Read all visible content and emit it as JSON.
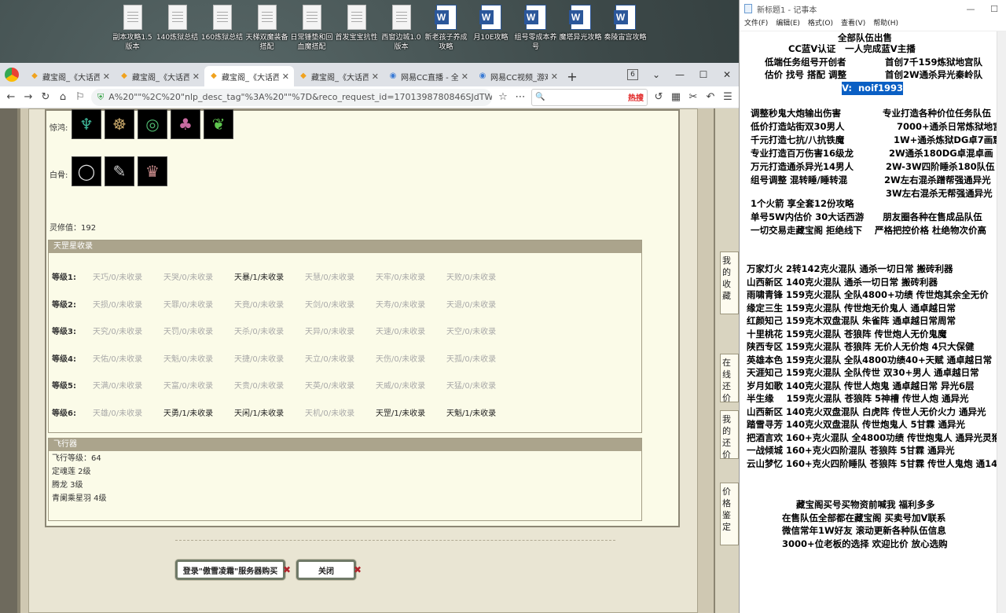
{
  "desktop": {
    "icons": [
      {
        "label": "副本攻略1.5版本",
        "type": "doc"
      },
      {
        "label": "140炼狱总结",
        "type": "doc"
      },
      {
        "label": "160炼狱总结",
        "type": "doc"
      },
      {
        "label": "天梯双魔装备搭配",
        "type": "doc"
      },
      {
        "label": "日常锤垫和回血魔搭配",
        "type": "doc"
      },
      {
        "label": "首发宝宝抗性",
        "type": "doc"
      },
      {
        "label": "西窗边城1.0版本",
        "type": "doc"
      },
      {
        "label": "新老孩子养成攻略",
        "type": "word"
      },
      {
        "label": "月10E攻略",
        "type": "word"
      },
      {
        "label": "组号零成本养号",
        "type": "word"
      },
      {
        "label": "魔塔异光攻略",
        "type": "word"
      },
      {
        "label": "奏陵宙宫攻略",
        "type": "word"
      }
    ]
  },
  "browser": {
    "tabs": [
      {
        "title": "藏宝阁_《大话西",
        "icon": "bao",
        "active": false
      },
      {
        "title": "藏宝阁_《大话西",
        "icon": "bao",
        "active": false
      },
      {
        "title": "藏宝阁_《大话西",
        "icon": "bao",
        "active": true
      },
      {
        "title": "藏宝阁_《大话西",
        "icon": "bao",
        "active": false
      },
      {
        "title": "网易CC直播 - 全",
        "icon": "cc",
        "active": false
      },
      {
        "title": "网易CC视频_游戏",
        "icon": "cc",
        "active": false
      }
    ],
    "tab_count": "6",
    "url": "A%20\"\"%2C%20\"nlp_desc_tag\"%3A%20\"\"%7D&reco_request_id=1701398780846SJdTW",
    "search_hot": "热搜"
  },
  "game": {
    "jinghong_label": "惊鸿:",
    "baifu_label": "白骨:",
    "lingxiu": "灵修值：192",
    "tiangang_header": "天罡星收录",
    "grades": [
      {
        "label": "等级1:",
        "cells": [
          {
            "t": "天巧/0/未收录",
            "on": false
          },
          {
            "t": "天哭/0/未收录",
            "on": false
          },
          {
            "t": "天暴/1/未收录",
            "on": true
          },
          {
            "t": "天慧/0/未收录",
            "on": false
          },
          {
            "t": "天牢/0/未收录",
            "on": false
          },
          {
            "t": "天败/0/未收录",
            "on": false
          }
        ]
      },
      {
        "label": "等级2:",
        "cells": [
          {
            "t": "天损/0/未收录",
            "on": false
          },
          {
            "t": "天罪/0/未收录",
            "on": false
          },
          {
            "t": "天竟/0/未收录",
            "on": false
          },
          {
            "t": "天剑/0/未收录",
            "on": false
          },
          {
            "t": "天寿/0/未收录",
            "on": false
          },
          {
            "t": "天退/0/未收录",
            "on": false
          }
        ]
      },
      {
        "label": "等级3:",
        "cells": [
          {
            "t": "天究/0/未收录",
            "on": false
          },
          {
            "t": "天罚/0/未收录",
            "on": false
          },
          {
            "t": "天杀/0/未收录",
            "on": false
          },
          {
            "t": "天异/0/未收录",
            "on": false
          },
          {
            "t": "天速/0/未收录",
            "on": false
          },
          {
            "t": "天空/0/未收录",
            "on": false
          }
        ]
      },
      {
        "label": "等级4:",
        "cells": [
          {
            "t": "天佑/0/未收录",
            "on": false
          },
          {
            "t": "天魁/0/未收录",
            "on": false
          },
          {
            "t": "天捷/0/未收录",
            "on": false
          },
          {
            "t": "天立/0/未收录",
            "on": false
          },
          {
            "t": "天伤/0/未收录",
            "on": false
          },
          {
            "t": "天孤/0/未收录",
            "on": false
          }
        ]
      },
      {
        "label": "等级5:",
        "cells": [
          {
            "t": "天满/0/未收录",
            "on": false
          },
          {
            "t": "天富/0/未收录",
            "on": false
          },
          {
            "t": "天贵/0/未收录",
            "on": false
          },
          {
            "t": "天英/0/未收录",
            "on": false
          },
          {
            "t": "天威/0/未收录",
            "on": false
          },
          {
            "t": "天猛/0/未收录",
            "on": false
          }
        ]
      },
      {
        "label": "等级6:",
        "cells": [
          {
            "t": "天雄/0/未收录",
            "on": false
          },
          {
            "t": "天勇/1/未收录",
            "on": true
          },
          {
            "t": "天闲/1/未收录",
            "on": true
          },
          {
            "t": "天机/0/未收录",
            "on": false
          },
          {
            "t": "天罡/1/未收录",
            "on": true
          },
          {
            "t": "天魁/1/未收录",
            "on": true
          }
        ]
      }
    ],
    "fly_header": "飞行器",
    "fly_lines": [
      "飞行等级：64",
      "定魂莲   2级",
      "腾龙   3级",
      "青阑乘星羽   4级"
    ],
    "login_button": "登录\"傲雪凌霜\"服务器购买",
    "close_button": "关闭",
    "side_panels": [
      "我的收藏",
      "在线还价",
      "我的还价",
      "价格鉴定"
    ]
  },
  "notepad": {
    "title": "新标题1 - 记事本",
    "menu": [
      "文件(F)",
      "编辑(E)",
      "格式(O)",
      "查看(V)",
      "帮助(H)"
    ],
    "header_lines": [
      "全部队伍出售",
      "CC蓝V认证   一人完成蓝V主播",
      "低端任务组号开创者",
      "首创7千159炼狱地宫队",
      "估价 找号 搭配 调整",
      "首创2W通杀异光秦岭队"
    ],
    "vx": "V:  noif1993",
    "left_col": [
      "调整秒鬼大炮输出伤害",
      "低价打造站街双30男人",
      "千元打造七抗/八抗铁魔",
      "专业打造百万伤害16级龙",
      "万元打造通杀异光14男人",
      "组号调整 混转睡/睡转混"
    ],
    "right_col": [
      "专业打造各种价位任务队伍",
      "7000+通杀日常炼狱地宫",
      "1W+通杀炼狱DG卓7画窟",
      "2W通杀180DG卓混卓画",
      "2W-3W四阶睡杀180队伍",
      "2W左右混杀蹭帮强通异光",
      "3W左右混杀无帮强通异光"
    ],
    "mid_lines": [
      "1个火箭 享全套12份攻略",
      "单号5W内估价 30大话西游      朋友圈各种在售成品队伍",
      "一切交易走藏宝阁 拒绝线下    严格把控价格 杜绝物次价高"
    ],
    "team_lines": [
      "万家灯火 2转142克火混队 通杀一切日常 搬砖利器",
      "山西新区 140克火混队 通杀一切日常 搬砖利器",
      "雨啸青锋 159克火混队 全队4800+功绩 传世炮其余全无价",
      "缘定三生 159克火混队 传世炮无价鬼人 通卓越日常",
      "红颜知己 159克木双盘混队 朱雀阵 通卓越日常周常",
      "十里桃花 159克火混队 苍狼阵 传世炮人无价鬼魔",
      "陕西专区 159克火混队 苍狼阵 无价人无价炮 4只大保健",
      "英雄本色 159克火混队 全队4800功绩40+天赋 通卓越日常",
      "天涯知己 159克火混队 全队传世 双30+男人 通卓越日常",
      "岁月如歌 140克火混队 传世人炮鬼 通卓越日常 异光6层",
      "半生缘    159克火混队 苍狼阵 5神槽 传世人炮 通异光",
      "山西新区 140克火双盘混队 白虎阵 传世人无价火力 通异光",
      "踏雪寻芳 140克火双盘混队 传世炮鬼人 5甘霖 通异光",
      "把酒言欢 160+克火混队 全4800功绩 传世炮鬼人 通异光灵猴",
      "一战倾城 160+克火四阶混队 苍狼阵 5甘霖 通异光",
      "云山梦忆 160+克火四阶睡队 苍狼阵 5甘霖 传世人鬼炮 通14"
    ],
    "footer_lines": [
      "藏宝阁买号买物资前喊我 福利多多",
      "在售队伍全部都在藏宝阁 买卖号加V联系",
      "微信常年1W好友 滚动更新各种队伍信息",
      "3000+位老板的选择 欢迎比价 放心选购"
    ]
  }
}
